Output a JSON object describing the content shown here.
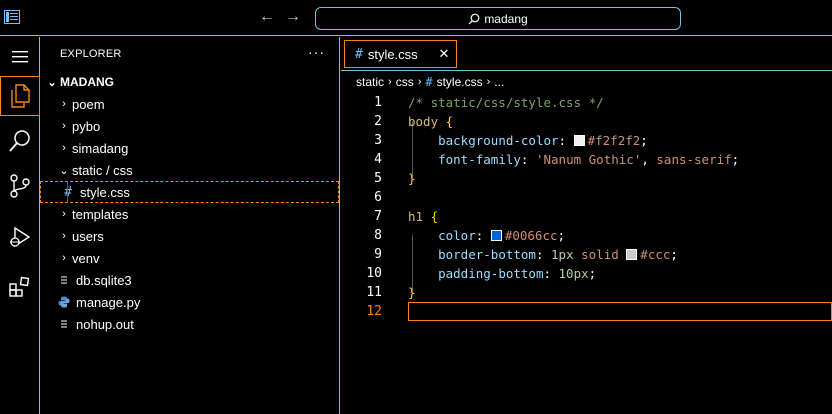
{
  "titlebar": {
    "search_text": "madang",
    "nav_back": "←",
    "nav_forward": "→"
  },
  "activity": [
    "explorer-icon",
    "search-icon",
    "source-control-icon",
    "run-debug-icon",
    "extensions-icon"
  ],
  "sidebar": {
    "title": "EXPLORER",
    "more": "···",
    "root": "MADANG",
    "items": [
      {
        "label": "poem",
        "type": "folder"
      },
      {
        "label": "pybo",
        "type": "folder"
      },
      {
        "label": "simadang",
        "type": "folder"
      },
      {
        "label": "static / css",
        "type": "folder-open"
      },
      {
        "label": "style.css",
        "type": "css-file"
      },
      {
        "label": "templates",
        "type": "folder"
      },
      {
        "label": "users",
        "type": "folder"
      },
      {
        "label": "venv",
        "type": "folder"
      },
      {
        "label": "db.sqlite3",
        "type": "file"
      },
      {
        "label": "manage.py",
        "type": "python-file"
      },
      {
        "label": "nohup.out",
        "type": "file"
      }
    ]
  },
  "tab": {
    "hash": "#",
    "label": "style.css",
    "close": "✕"
  },
  "breadcrumbs": [
    "static",
    "css",
    "style.css",
    "..."
  ],
  "editor": {
    "line_numbers": [
      "1",
      "2",
      "3",
      "4",
      "5",
      "6",
      "7",
      "8",
      "9",
      "10",
      "11",
      "12"
    ],
    "comment": "/* static/css/style.css */",
    "body_sel": "body",
    "bg_prop": "background-color",
    "bg_val": "#f2f2f2",
    "ff_prop": "font-family",
    "ff_str": "'Nanum Gothic'",
    "ff_val": "sans-serif",
    "h1_sel": "h1",
    "color_prop": "color",
    "color_val": "#0066cc",
    "bb_prop": "border-bottom",
    "bb_num": "1px",
    "bb_val": "solid",
    "bb_color": "#ccc",
    "pb_prop": "padding-bottom",
    "pb_num": "10px",
    "open_brace": "{",
    "close_brace": "}",
    "colon": ":",
    "semicolon": ";",
    "comma": ","
  },
  "colors": {
    "accent_border": "#6fc3df",
    "focus_orange": "#f38518",
    "swatch_bg": "#f2f2f2",
    "swatch_blue": "#0066cc",
    "swatch_ccc": "#cccccc"
  }
}
